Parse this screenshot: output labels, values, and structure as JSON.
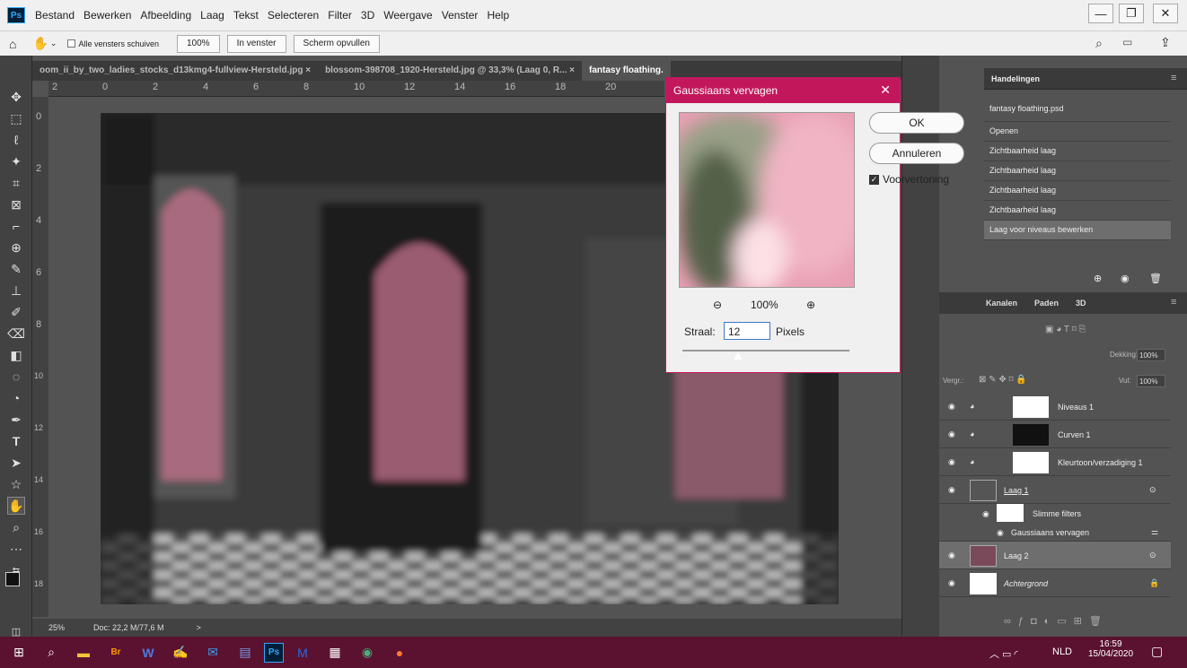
{
  "menu": {
    "items": [
      "Bestand",
      "Bewerken",
      "Afbeelding",
      "Laag",
      "Tekst",
      "Selecteren",
      "Filter",
      "3D",
      "Weergave",
      "Venster",
      "Help"
    ]
  },
  "options": {
    "all_windows": "Alle vensters schuiven",
    "zoom100": "100%",
    "fit_window": "In venster",
    "fill_screen": "Scherm opvullen"
  },
  "tabs": [
    {
      "label": "oom_ii_by_two_ladies_stocks_d13kmg4-fullview-Hersteld.jpg"
    },
    {
      "label": "blossom-398708_1920-Hersteld.jpg @ 33,3% (Laag 0, R..."
    },
    {
      "label": "fantasy floathing."
    }
  ],
  "tab_close": "×",
  "ruler": {
    "h": [
      "2",
      "0",
      "2",
      "4",
      "6",
      "8",
      "10",
      "12",
      "14",
      "16",
      "18",
      "20"
    ],
    "v": [
      "0",
      "2",
      "4",
      "6",
      "8",
      "10",
      "12",
      "14",
      "16",
      "18"
    ]
  },
  "status": {
    "zoom": "25%",
    "doc": "Doc: 22,2 M/77,6 M",
    "arrow": ">"
  },
  "actions_panel": {
    "title": "Handelingen",
    "file": "fantasy floathing.psd",
    "items": [
      "Openen",
      "Zichtbaarheid laag",
      "Zichtbaarheid laag",
      "Zichtbaarheid laag",
      "Zichtbaarheid laag",
      "Laag voor niveaus bewerken"
    ]
  },
  "layers_panel": {
    "tabs": [
      "Kanalen",
      "Paden",
      "3D"
    ],
    "opacity_label": "Dekking:",
    "opacity": "100%",
    "lock_label": "Vergr.:",
    "fill_label": "Vul:",
    "fill": "100%",
    "layers": [
      {
        "name": "Niveaus 1"
      },
      {
        "name": "Curven 1"
      },
      {
        "name": "Kleurtoon/verzadiging 1"
      },
      {
        "name": "Laag 1"
      },
      {
        "name": "Slimme filters"
      },
      {
        "name": "Gaussiaans vervagen"
      },
      {
        "name": "Laag 2"
      },
      {
        "name": "Achtergrond"
      }
    ]
  },
  "dialog": {
    "title": "Gaussiaans vervagen",
    "ok": "OK",
    "cancel": "Annuleren",
    "preview": "Voorvertoning",
    "zoom": "100%",
    "radius_label": "Straal:",
    "radius": "12",
    "units": "Pixels",
    "radius_fraction": 0.04
  },
  "taskbar": {
    "lang": "NLD",
    "time": "16:59",
    "date": "15/04/2020"
  },
  "colors": {
    "accent": "#c2185b",
    "taskbar": "#5a1230",
    "ps_bg": "#535353"
  }
}
